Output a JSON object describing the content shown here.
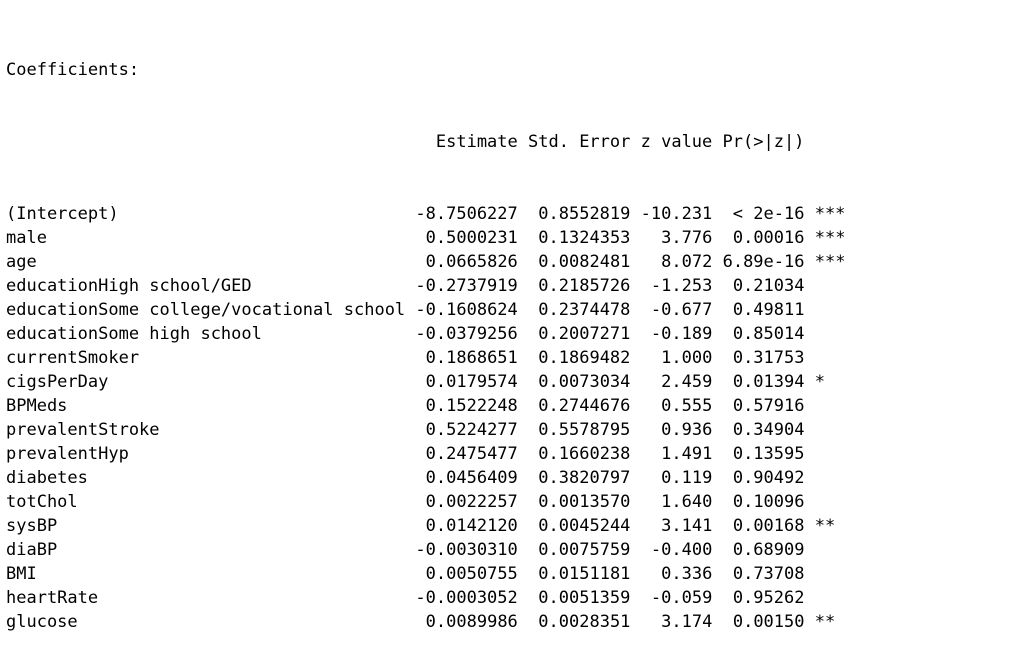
{
  "heading": "Coefficients:",
  "columns": [
    "Estimate",
    "Std. Error",
    "z value",
    "Pr(>|z|)"
  ],
  "rows": [
    {
      "term": "(Intercept)",
      "estimate": "-8.7506227",
      "std_error": "0.8552819",
      "z_value": "-10.231",
      "p_value": "< 2e-16",
      "signif": "***"
    },
    {
      "term": "male",
      "estimate": "0.5000231",
      "std_error": "0.1324353",
      "z_value": "3.776",
      "p_value": "0.00016",
      "signif": "***"
    },
    {
      "term": "age",
      "estimate": "0.0665826",
      "std_error": "0.0082481",
      "z_value": "8.072",
      "p_value": "6.89e-16",
      "signif": "***"
    },
    {
      "term": "educationHigh school/GED",
      "estimate": "-0.2737919",
      "std_error": "0.2185726",
      "z_value": "-1.253",
      "p_value": "0.21034",
      "signif": ""
    },
    {
      "term": "educationSome college/vocational school",
      "estimate": "-0.1608624",
      "std_error": "0.2374478",
      "z_value": "-0.677",
      "p_value": "0.49811",
      "signif": ""
    },
    {
      "term": "educationSome high school",
      "estimate": "-0.0379256",
      "std_error": "0.2007271",
      "z_value": "-0.189",
      "p_value": "0.85014",
      "signif": ""
    },
    {
      "term": "currentSmoker",
      "estimate": "0.1868651",
      "std_error": "0.1869482",
      "z_value": "1.000",
      "p_value": "0.31753",
      "signif": ""
    },
    {
      "term": "cigsPerDay",
      "estimate": "0.0179574",
      "std_error": "0.0073034",
      "z_value": "2.459",
      "p_value": "0.01394",
      "signif": "*"
    },
    {
      "term": "BPMeds",
      "estimate": "0.1522248",
      "std_error": "0.2744676",
      "z_value": "0.555",
      "p_value": "0.57916",
      "signif": ""
    },
    {
      "term": "prevalentStroke",
      "estimate": "0.5224277",
      "std_error": "0.5578795",
      "z_value": "0.936",
      "p_value": "0.34904",
      "signif": ""
    },
    {
      "term": "prevalentHyp",
      "estimate": "0.2475477",
      "std_error": "0.1660238",
      "z_value": "1.491",
      "p_value": "0.13595",
      "signif": ""
    },
    {
      "term": "diabetes",
      "estimate": "0.0456409",
      "std_error": "0.3820797",
      "z_value": "0.119",
      "p_value": "0.90492",
      "signif": ""
    },
    {
      "term": "totChol",
      "estimate": "0.0022257",
      "std_error": "0.0013570",
      "z_value": "1.640",
      "p_value": "0.10096",
      "signif": ""
    },
    {
      "term": "sysBP",
      "estimate": "0.0142120",
      "std_error": "0.0045244",
      "z_value": "3.141",
      "p_value": "0.00168",
      "signif": "**"
    },
    {
      "term": "diaBP",
      "estimate": "-0.0030310",
      "std_error": "0.0075759",
      "z_value": "-0.400",
      "p_value": "0.68909",
      "signif": ""
    },
    {
      "term": "BMI",
      "estimate": "0.0050755",
      "std_error": "0.0151181",
      "z_value": "0.336",
      "p_value": "0.73708",
      "signif": ""
    },
    {
      "term": "heartRate",
      "estimate": "-0.0003052",
      "std_error": "0.0051359",
      "z_value": "-0.059",
      "p_value": "0.95262",
      "signif": ""
    },
    {
      "term": "glucose",
      "estimate": "0.0089986",
      "std_error": "0.0028351",
      "z_value": "3.174",
      "p_value": "0.00150",
      "signif": "**"
    }
  ]
}
